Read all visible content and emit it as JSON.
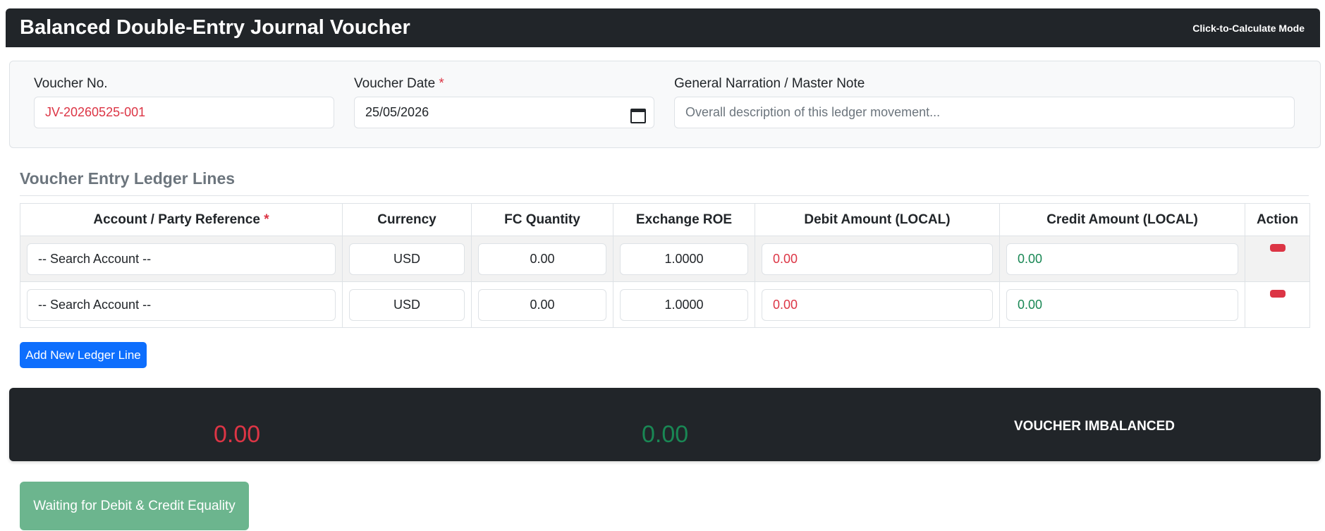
{
  "header": {
    "title": "Balanced Double-Entry Journal Voucher",
    "mode": "Click-to-Calculate Mode"
  },
  "form": {
    "voucher_no_label": "Voucher No.",
    "voucher_no_value": "JV-20260525-001",
    "voucher_date_label": "Voucher Date",
    "required_mark": "*",
    "voucher_date_value": "25/05/2026",
    "narration_label": "General Narration / Master Note",
    "narration_placeholder": "Overall description of this ledger movement..."
  },
  "ledger": {
    "section_title": "Voucher Entry Ledger Lines",
    "columns": {
      "account": "Account / Party Reference",
      "currency": "Currency",
      "fc_quantity": "FC Quantity",
      "exchange_roe": "Exchange ROE",
      "debit": "Debit Amount (LOCAL)",
      "credit": "Credit Amount (LOCAL)",
      "action": "Action"
    },
    "rows": [
      {
        "account": "-- Search Account --",
        "currency": "USD",
        "fc_quantity": "0.00",
        "exchange_roe": "1.0000",
        "debit": "0.00",
        "credit": "0.00"
      },
      {
        "account": "-- Search Account --",
        "currency": "USD",
        "fc_quantity": "0.00",
        "exchange_roe": "1.0000",
        "debit": "0.00",
        "credit": "0.00"
      }
    ],
    "add_button": "Add New Ledger Line"
  },
  "totals": {
    "debit_total": "0.00",
    "credit_total": "0.00",
    "status": "VOUCHER IMBALANCED"
  },
  "submit": {
    "label": "Waiting for Debit & Credit Equality"
  },
  "colors": {
    "dark": "#212529",
    "debit": "#dc3545",
    "credit": "#198754",
    "primary": "#0d6efd",
    "disabled_success": "#6cb58e"
  }
}
